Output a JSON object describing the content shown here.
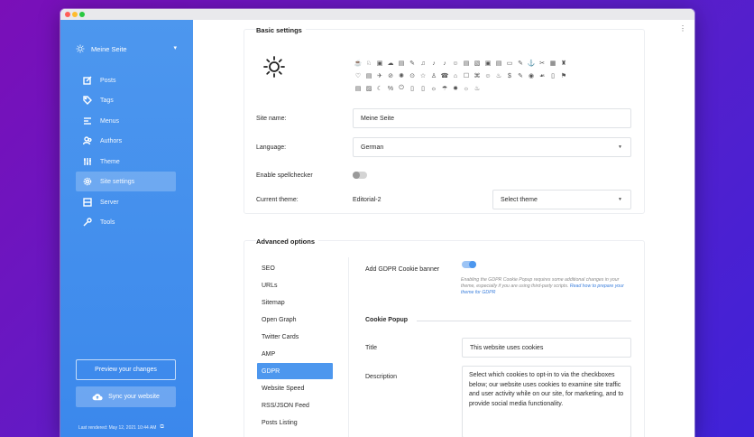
{
  "colors": {
    "accent": "#4d97ee",
    "sidebar": "#3b88ec",
    "toggle_on": "#4d97ee",
    "toggle_off": "#9a9a9a"
  },
  "window": {
    "traffic_lights": [
      "#ff5f57",
      "#febc2e",
      "#28c840"
    ]
  },
  "sidebar": {
    "site_name": "Meine Seite",
    "site_icon": "sun-icon",
    "items": [
      {
        "label": "Posts",
        "icon": "edit-icon"
      },
      {
        "label": "Tags",
        "icon": "tag-icon"
      },
      {
        "label": "Menus",
        "icon": "menu-icon"
      },
      {
        "label": "Authors",
        "icon": "users-icon"
      },
      {
        "label": "Theme",
        "icon": "sliders-icon"
      },
      {
        "label": "Site settings",
        "icon": "gear-icon",
        "active": true
      },
      {
        "label": "Server",
        "icon": "server-icon"
      },
      {
        "label": "Tools",
        "icon": "wrench-icon"
      }
    ],
    "preview_label": "Preview your changes",
    "sync_label": "Sync your website",
    "last_rendered": "Last rendered: May 12, 2021 10:44 AM"
  },
  "basic": {
    "title": "Basic settings",
    "site_name_label": "Site name:",
    "site_name_value": "Meine Seite",
    "language_label": "Language:",
    "language_value": "German",
    "spellcheck_label": "Enable spellchecker",
    "spellcheck_on": false,
    "theme_label": "Current theme:",
    "theme_value": "Editorial-2",
    "select_theme_value": "Select theme"
  },
  "advanced": {
    "title": "Advanced options",
    "tabs": [
      {
        "label": "SEO"
      },
      {
        "label": "URLs"
      },
      {
        "label": "Sitemap"
      },
      {
        "label": "Open Graph"
      },
      {
        "label": "Twitter Cards"
      },
      {
        "label": "AMP"
      },
      {
        "label": "GDPR",
        "active": true
      },
      {
        "label": "Website Speed"
      },
      {
        "label": "RSS/JSON Feed"
      },
      {
        "label": "Posts Listing"
      }
    ],
    "gdpr_banner_label": "Add GDPR Cookie banner",
    "gdpr_banner_on": true,
    "gdpr_hint_1": "Enabling the GDPR Cookie Popup requires some additional changes in your theme, especially if you are using third-party scripts.",
    "gdpr_hint_link": "Read how to prepare your theme for GDPR",
    "cookie_popup_heading": "Cookie Popup",
    "title_label": "Title",
    "title_value": "This website uses cookies",
    "description_label": "Description",
    "description_value": "Select which cookies to opt-in to via the checkboxes below; our website uses cookies to examine site traffic and user activity while on our site, for marketing, and to provide social media functionality."
  },
  "icon_grid": {
    "glyphs": [
      "☕",
      "♘",
      "▣",
      "☁",
      "▤",
      "✎",
      "♫",
      "♪",
      "♪",
      "☺",
      "▤",
      "▧",
      "▣",
      "▤",
      "▭",
      "✎",
      "⚓",
      "✂",
      "▦",
      "♜",
      "♡",
      "▤",
      "✈",
      "⊘",
      "✺",
      "⊙",
      "☆",
      "♙",
      "☎",
      "⌂",
      "☐",
      "⌘",
      "☺",
      "♨",
      "$",
      "✎",
      "◉",
      "☙",
      "▯",
      "⚑",
      "▤",
      "▨",
      "☾",
      "%",
      "⏻",
      "▯",
      "▯",
      "☼",
      "☂",
      "✸",
      "☼",
      "♨"
    ],
    "selected_index": 47
  }
}
